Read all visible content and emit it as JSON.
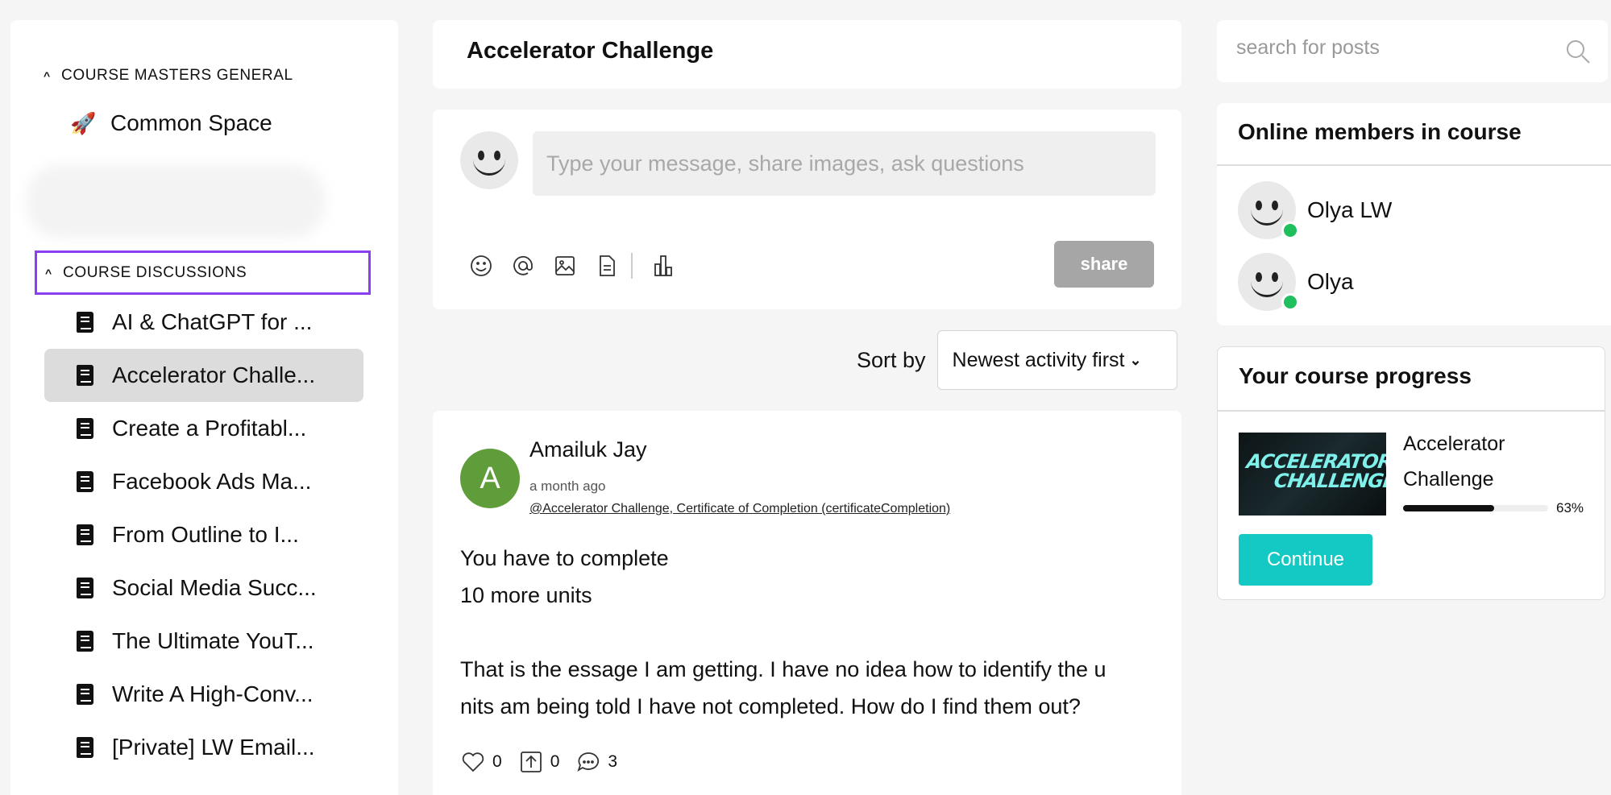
{
  "sidebar": {
    "group1_title": "COURSE MASTERS GENERAL",
    "common_space": "Common Space",
    "group2_title": "COURSE DISCUSSIONS",
    "courses": [
      {
        "label": "AI & ChatGPT for ...",
        "active": false
      },
      {
        "label": "Accelerator Challe...",
        "active": true
      },
      {
        "label": "Create a Profitabl...",
        "active": false
      },
      {
        "label": "Facebook Ads Ma...",
        "active": false
      },
      {
        "label": "From Outline to I...",
        "active": false
      },
      {
        "label": "Social Media Succ...",
        "active": false
      },
      {
        "label": "The Ultimate YouT...",
        "active": false
      },
      {
        "label": "Write A High-Conv...",
        "active": false
      },
      {
        "label": "[Private] LW Email...",
        "active": false
      }
    ]
  },
  "main": {
    "title": "Accelerator Challenge",
    "composer_placeholder": "Type your message, share images, ask questions",
    "share_label": "share",
    "sort_label": "Sort by",
    "sort_value": "Newest activity first"
  },
  "post": {
    "avatar_letter": "A",
    "author": "Amailuk Jay",
    "time": "a month ago",
    "tag": "@Accelerator Challenge, Certificate of Completion (certificateCompletion)",
    "body": [
      "You have to complete",
      "10 more units",
      "",
      "That is the essage I am getting. I have no idea how to identify the u",
      "nits am being told I have not completed. How do I find them out?"
    ],
    "likes": "0",
    "upvotes": "0",
    "comments": "3"
  },
  "right": {
    "search_placeholder": "search for posts",
    "online_title": "Online members in course",
    "members": [
      "Olya LW",
      "Olya"
    ],
    "progress_title": "Your course progress",
    "thumb_line1": "ACCELERATOR",
    "thumb_line2": "CHALLENGE",
    "course_name": "Accelerator Challenge",
    "progress_percent": 63,
    "progress_text": "63%",
    "continue_label": "Continue"
  },
  "colors": {
    "accent": "#14c8c3",
    "highlight_border": "#8a3ff0",
    "online_dot": "#1fbf5e",
    "post_avatar": "#5f9d3a"
  }
}
